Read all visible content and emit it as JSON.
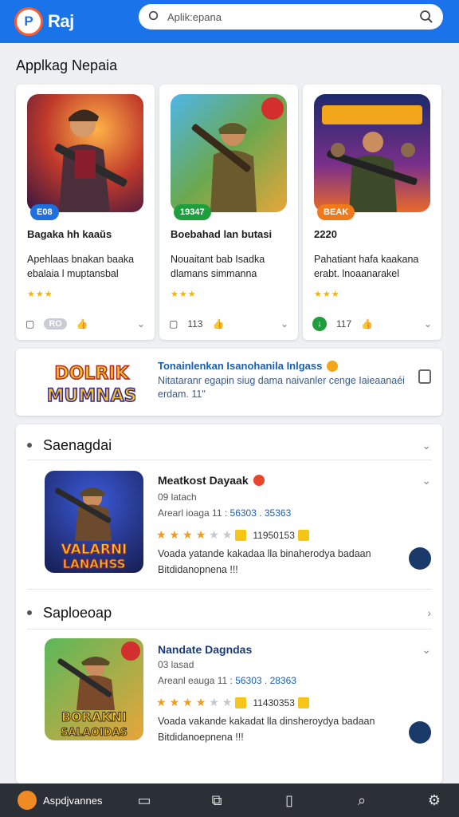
{
  "header": {
    "logo_mark": "P",
    "logo_text": "Raj",
    "search_placeholder": "Aplik:epana",
    "brand_color": "#1a73e8"
  },
  "section_title": "Applkag Nepaia",
  "cards": [
    {
      "badge": "E08",
      "badge_color": "#1e6fe0",
      "title": "Bagaka hh kaaŭs",
      "description": "Apehlaas bnakan baaka ebalaia l muptansbal",
      "rating": 3,
      "foot_chip": "RO",
      "foot_count": ""
    },
    {
      "badge": "19347",
      "badge_color": "#1e9e3c",
      "title": "Boebahad lan butasi",
      "description": "Nouaitant bab Isadka dlamans simmanna",
      "rating": 3,
      "foot_chip": "",
      "foot_count": "113"
    },
    {
      "badge": "BEAK",
      "badge_color": "#f07a1a",
      "title": "2220",
      "description": "Pahatiant hafa kaakana erabt. lnoaanarakel",
      "rating": 3,
      "foot_chip": "",
      "foot_count": "117"
    }
  ],
  "promo": {
    "logo_line1": "DOLRIK",
    "logo_line2": "MUMNAS",
    "title": "Tonainlenkan Isanohanila Inlgass",
    "description": "Nitataranr egapin siug dama naivanler cenge Iaieaanaéi erdam. 11\""
  },
  "groups": [
    {
      "label": "Saenagdai",
      "item": {
        "art_line1": "VALARNI",
        "art_line2": "LANAHSS",
        "title": "Meatkost Dayaak",
        "subtitle": "09 latach",
        "meta_prefix": "Arearl ioaga 11 :",
        "meta_value": "56303 . 35363",
        "rating": 4,
        "rating_count": "11950153",
        "note": "Voada yatande kakadaa lla binaherodya badaan Bitdidanopnena !!!"
      }
    },
    {
      "label": "Saploeoap",
      "item": {
        "art_line1": "BORAKNI",
        "art_line2": "SALAOIDAS",
        "title": "Nandate Dagndas",
        "subtitle": "03 lasad",
        "meta_prefix": "Areanl eauga 11 :",
        "meta_value": "56303 . 28363",
        "rating": 4,
        "rating_count": "11430353",
        "note": "Voada vakande kakadat lla dinsheroydya badaan Bitdidanoepnena !!!"
      }
    }
  ],
  "bottom_bar": {
    "home_label": "Aspdjvannes",
    "icons": [
      "chat-icon",
      "puzzle-icon",
      "devices-icon",
      "search-icon",
      "settings-icon"
    ]
  }
}
